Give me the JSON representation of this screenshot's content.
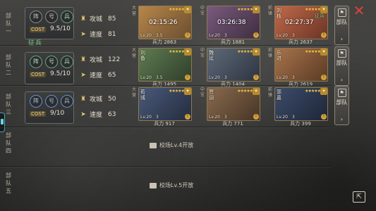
{
  "close_icon": "✕",
  "share_icon": "⇱",
  "rows": [
    {
      "label": "部队一",
      "formation_slots": [
        "阵",
        "号",
        "兵"
      ],
      "slot_colors": [
        "",
        "",
        "green"
      ],
      "cost_label": "COST",
      "cost": "9.5/10",
      "tag": "征兵",
      "attack_label": "攻城",
      "attack": "85",
      "speed_label": "速度",
      "speed": "81",
      "heroes": [
        {
          "side": "大营",
          "name": "",
          "stars": "★★★★★",
          "lv": "Lv.20",
          "cost": "3.5",
          "timer": "02:15:26",
          "sub": "",
          "troops_label": "兵力",
          "troops": "2863"
        },
        {
          "side": "中军",
          "name": "",
          "stars": "★★★★★",
          "lv": "Lv.20",
          "cost": "3",
          "timer": "03:26:38",
          "sub": "",
          "troops_label": "兵力",
          "troops": "1881"
        },
        {
          "side": "前锋",
          "name": "刘枝",
          "stars": "★★★★★",
          "lv": "Lv.20",
          "cost": "3",
          "timer": "02:27:37",
          "sub": "征兵",
          "troops_label": "兵力",
          "troops": "2637"
        }
      ],
      "squad_button": "部队"
    },
    {
      "label": "部队二",
      "formation_slots": [
        "阵",
        "号",
        "兵"
      ],
      "slot_colors": [
        "green",
        "green",
        "green"
      ],
      "cost_label": "COST",
      "cost": "9.5/10",
      "tag": "",
      "attack_label": "攻城",
      "attack": "122",
      "speed_label": "速度",
      "speed": "65",
      "heroes": [
        {
          "side": "大营",
          "name": "刘备",
          "stars": "★★★★★",
          "lv": "Lv.20",
          "cost": "3.5",
          "timer": "",
          "sub": "",
          "troops_label": "兵力",
          "troops": "1495"
        },
        {
          "side": "中军",
          "name": "魏延",
          "stars": "★★★★★",
          "lv": "Lv.20",
          "cost": "3",
          "timer": "",
          "sub": "",
          "troops_label": "兵力",
          "troops": "1404"
        },
        {
          "side": "前锋",
          "name": "乐进",
          "stars": "★★★★★",
          "lv": "Lv.20",
          "cost": "3",
          "timer": "",
          "sub": "",
          "troops_label": "兵力",
          "troops": "2619"
        }
      ],
      "squad_button": "部队"
    },
    {
      "label": "部队三",
      "formation_slots": [
        "阵",
        "号",
        "兵"
      ],
      "slot_colors": [
        "blue",
        "blue",
        "blue"
      ],
      "cost_label": "COST",
      "cost": "9/10",
      "tag": "",
      "attack_label": "攻城",
      "attack": "50",
      "speed_label": "速度",
      "speed": "63",
      "heroes": [
        {
          "side": "大营",
          "name": "荀彧",
          "stars": "★★★★★",
          "lv": "Lv.20",
          "cost": "3",
          "timer": "",
          "sub": "",
          "troops_label": "兵力",
          "troops": "917"
        },
        {
          "side": "中军",
          "name": "贾诩",
          "stars": "★★★★★",
          "lv": "Lv.20",
          "cost": "3",
          "timer": "",
          "sub": "",
          "troops_label": "兵力",
          "troops": "771"
        },
        {
          "side": "前锋",
          "name": "郭嘉",
          "stars": "★★★★★",
          "lv": "Lv.20",
          "cost": "3",
          "timer": "",
          "sub": "",
          "troops_label": "兵力",
          "troops": "399"
        }
      ],
      "squad_button": "部队"
    },
    {
      "label": "部队四",
      "locked_text": "校场Lv.4开放"
    },
    {
      "label": "部队五",
      "locked_text": "校场Lv.5开放"
    }
  ]
}
